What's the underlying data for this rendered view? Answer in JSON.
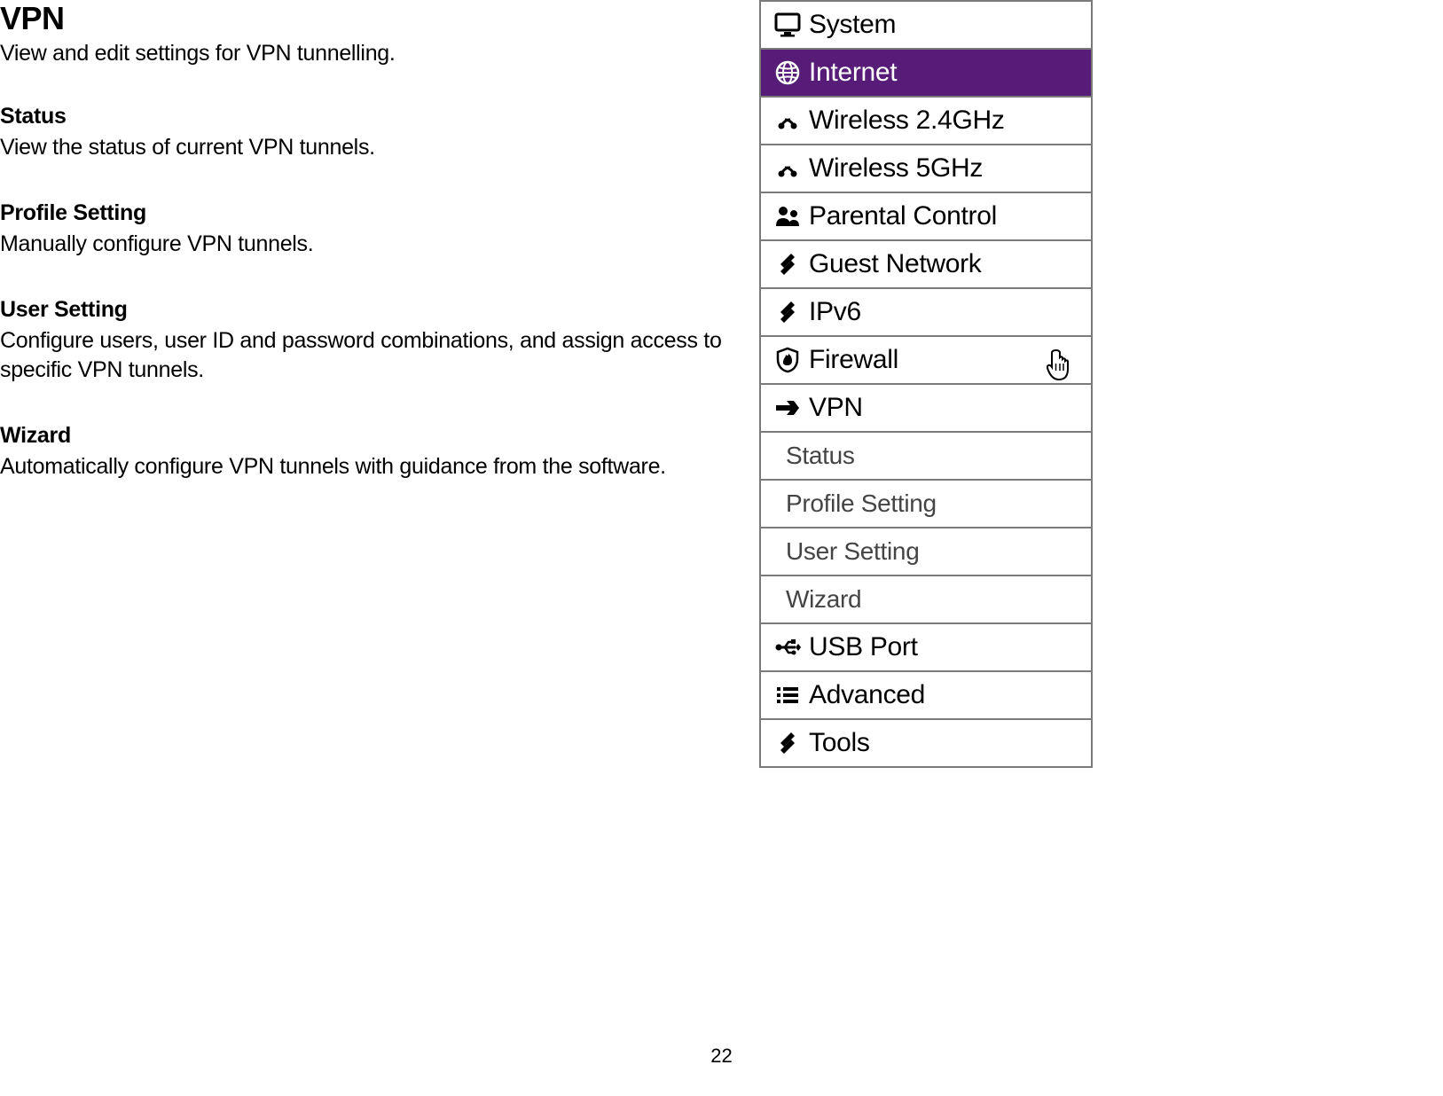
{
  "page": {
    "title": "VPN",
    "lead": "View and edit settings for VPN tunnelling.",
    "sections": [
      {
        "title": "Status",
        "body": "View the status of current VPN tunnels."
      },
      {
        "title": "Profile Setting",
        "body": "Manually configure VPN tunnels."
      },
      {
        "title": "User Setting",
        "body": "Configure users, user ID and password combinations, and assign access to specific VPN tunnels."
      },
      {
        "title": "Wizard",
        "body": "Automatically configure VPN tunnels with guidance from the software."
      }
    ],
    "page_number": "22"
  },
  "sidebar": {
    "items": [
      {
        "icon": "monitor",
        "label": "System",
        "active": false
      },
      {
        "icon": "globe",
        "label": "Internet",
        "active": true
      },
      {
        "icon": "signal",
        "label": "Wireless 2.4GHz",
        "active": false
      },
      {
        "icon": "signal",
        "label": "Wireless 5GHz",
        "active": false
      },
      {
        "icon": "people",
        "label": "Parental Control",
        "active": false
      },
      {
        "icon": "tools",
        "label": "Guest Network",
        "active": false
      },
      {
        "icon": "tools",
        "label": "IPv6",
        "active": false
      },
      {
        "icon": "shield",
        "label": "Firewall",
        "active": false,
        "cursor": true
      },
      {
        "icon": "vpn",
        "label": "VPN",
        "active": false,
        "subitems": [
          {
            "label": "Status"
          },
          {
            "label": "Profile Setting"
          },
          {
            "label": "User Setting"
          },
          {
            "label": "Wizard"
          }
        ]
      },
      {
        "icon": "usb",
        "label": "USB Port",
        "active": false
      },
      {
        "icon": "list",
        "label": "Advanced",
        "active": false
      },
      {
        "icon": "tools",
        "label": "Tools",
        "active": false
      }
    ]
  }
}
